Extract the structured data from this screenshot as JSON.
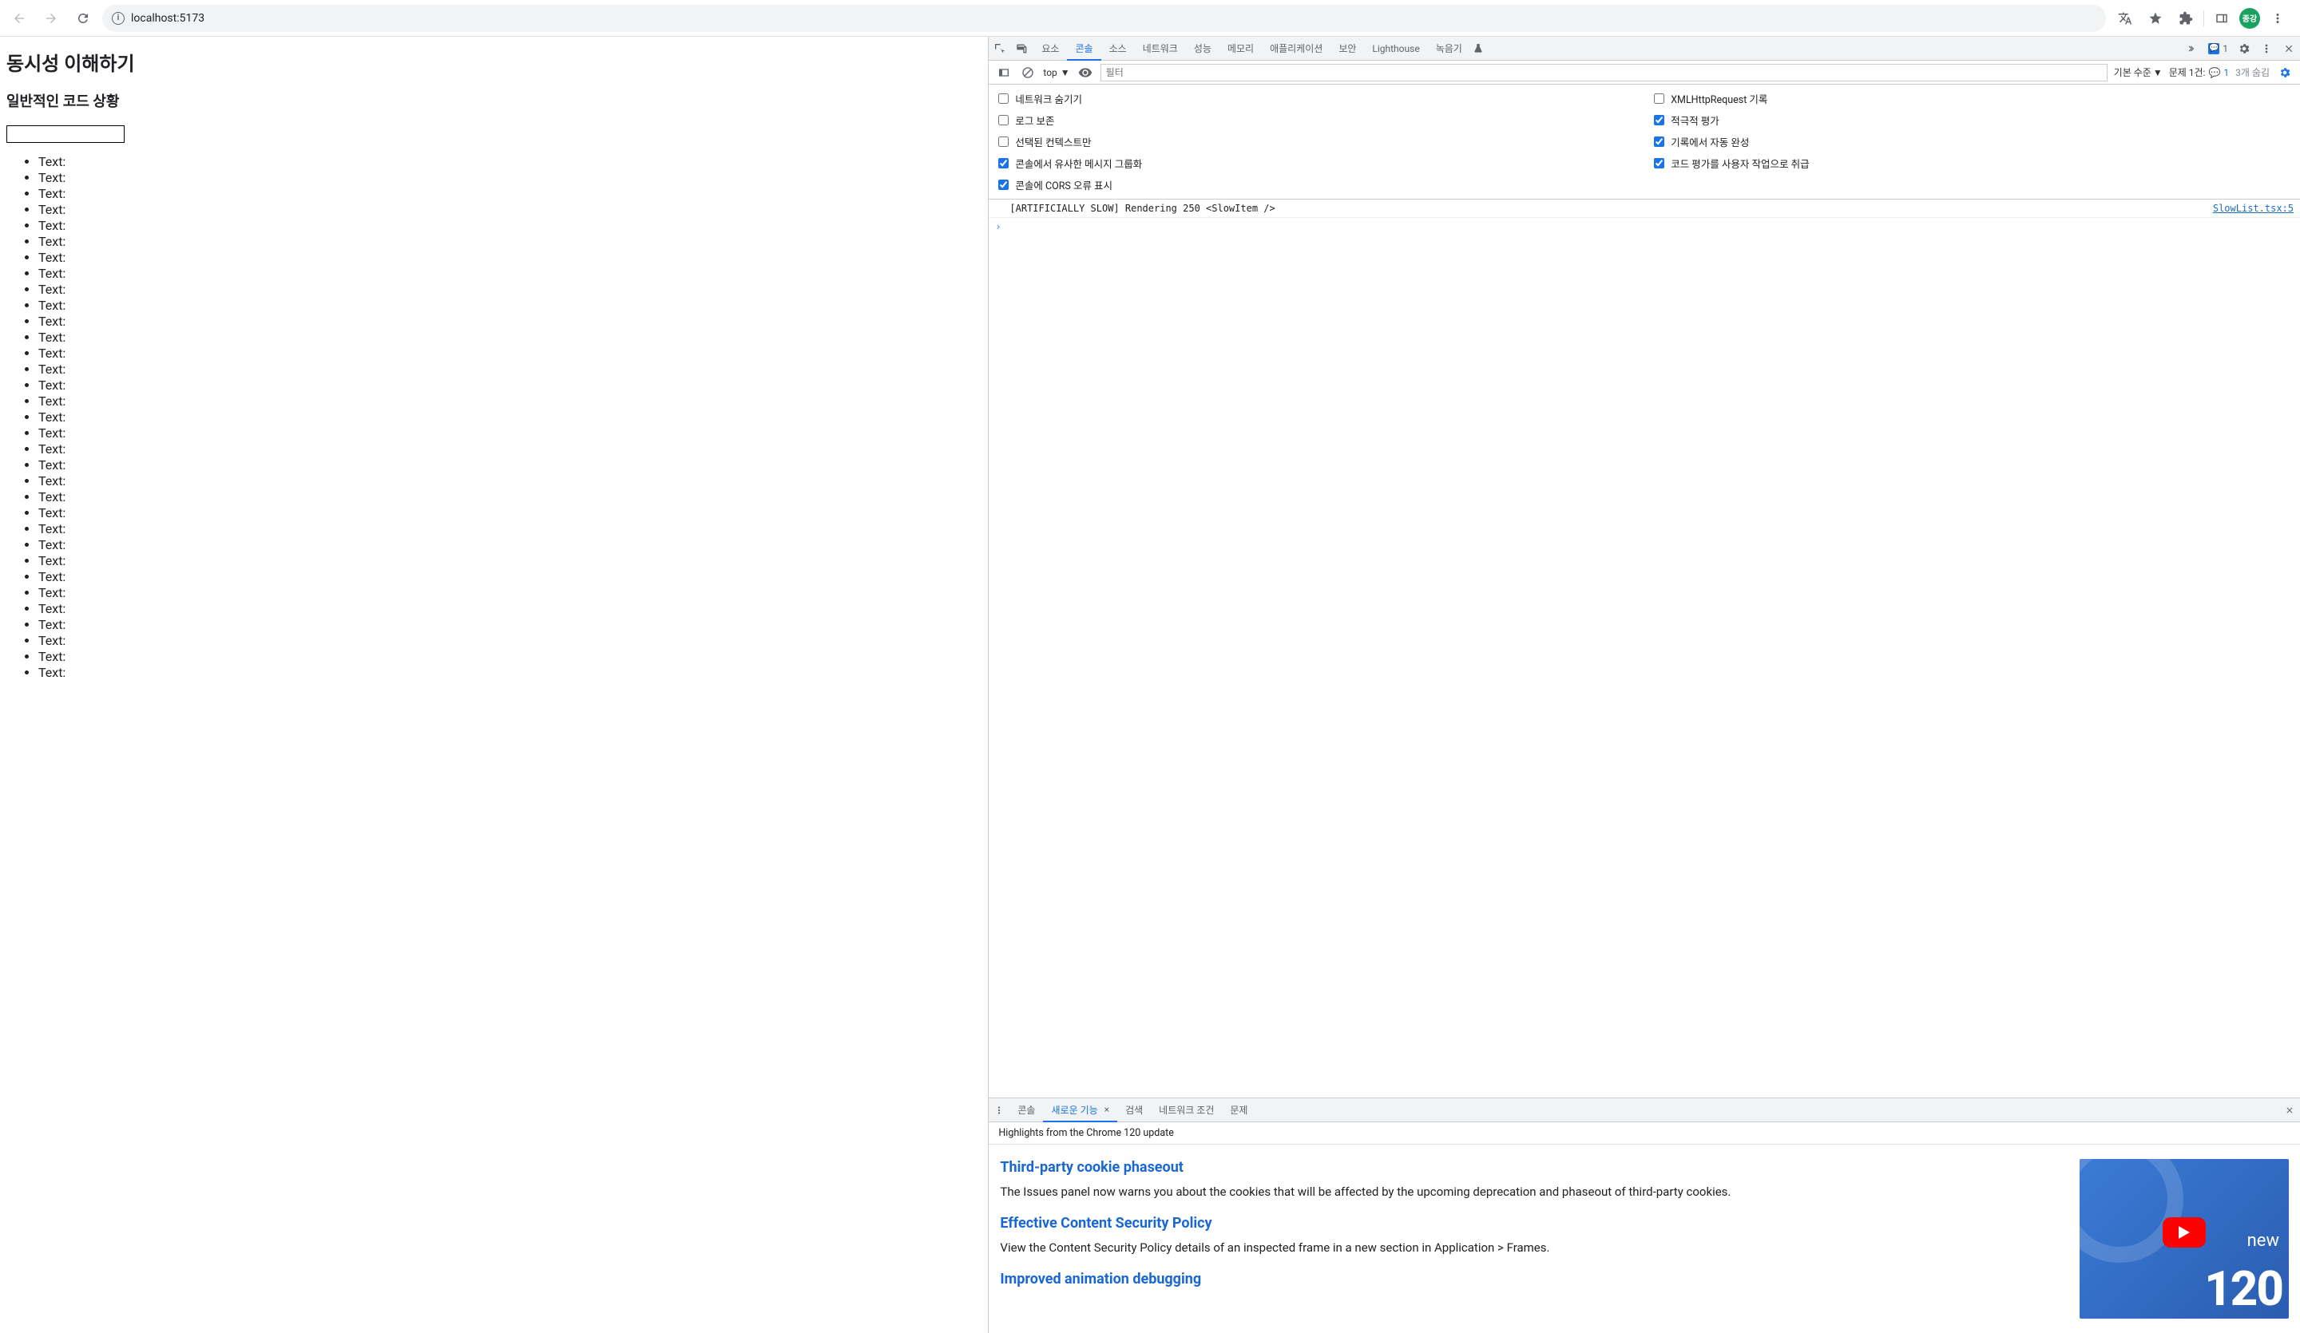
{
  "browser": {
    "url": "localhost:5173",
    "avatar_label": "종강"
  },
  "page": {
    "h1": "동시성 이해하기",
    "h2": "일반적인 코드 상황",
    "input_value": "",
    "list_item_text": "Text:",
    "list_count": 33
  },
  "devtools": {
    "tabs": [
      "요소",
      "콘솔",
      "소스",
      "네트워크",
      "성능",
      "메모리",
      "애플리케이션",
      "보안",
      "Lighthouse",
      "녹음기"
    ],
    "active_tab": "콘솔",
    "issues_badge": "1",
    "subbar": {
      "context": "top",
      "filter_placeholder": "필터",
      "level_label": "기본 수준",
      "issue_label": "문제 1건:",
      "issue_count": "1",
      "hidden_label": "3개 숨김"
    },
    "settings": {
      "left": [
        {
          "label": "네트워크 숨기기",
          "checked": false
        },
        {
          "label": "로그 보존",
          "checked": false
        },
        {
          "label": "선택된 컨텍스트만",
          "checked": false
        },
        {
          "label": "콘솔에서 유사한 메시지 그룹화",
          "checked": true
        },
        {
          "label": "콘솔에 CORS 오류 표시",
          "checked": true
        }
      ],
      "right": [
        {
          "label": "XMLHttpRequest 기록",
          "checked": false
        },
        {
          "label": "적극적 평가",
          "checked": true
        },
        {
          "label": "기록에서 자동 완성",
          "checked": true
        },
        {
          "label": "코드 평가를 사용자 작업으로 취급",
          "checked": true
        }
      ]
    },
    "log": {
      "message": "[ARTIFICIALLY SLOW] Rendering 250 <SlowItem />",
      "source": "SlowList.tsx:5"
    }
  },
  "drawer": {
    "tabs": [
      "콘솔",
      "새로운 기능",
      "검색",
      "네트워크 조건",
      "문제"
    ],
    "active_tab": "새로운 기능",
    "highlight_bar": "Highlights from the Chrome 120 update",
    "sections": [
      {
        "title": "Third-party cookie phaseout",
        "body": "The Issues panel now warns you about the cookies that will be affected by the upcoming deprecation and phaseout of third-party cookies."
      },
      {
        "title": "Effective Content Security Policy",
        "body": "View the Content Security Policy details of an inspected frame in a new section in Application > Frames."
      },
      {
        "title": "Improved animation debugging",
        "body": ""
      }
    ],
    "thumb": {
      "new": "new",
      "ver": "120"
    }
  }
}
